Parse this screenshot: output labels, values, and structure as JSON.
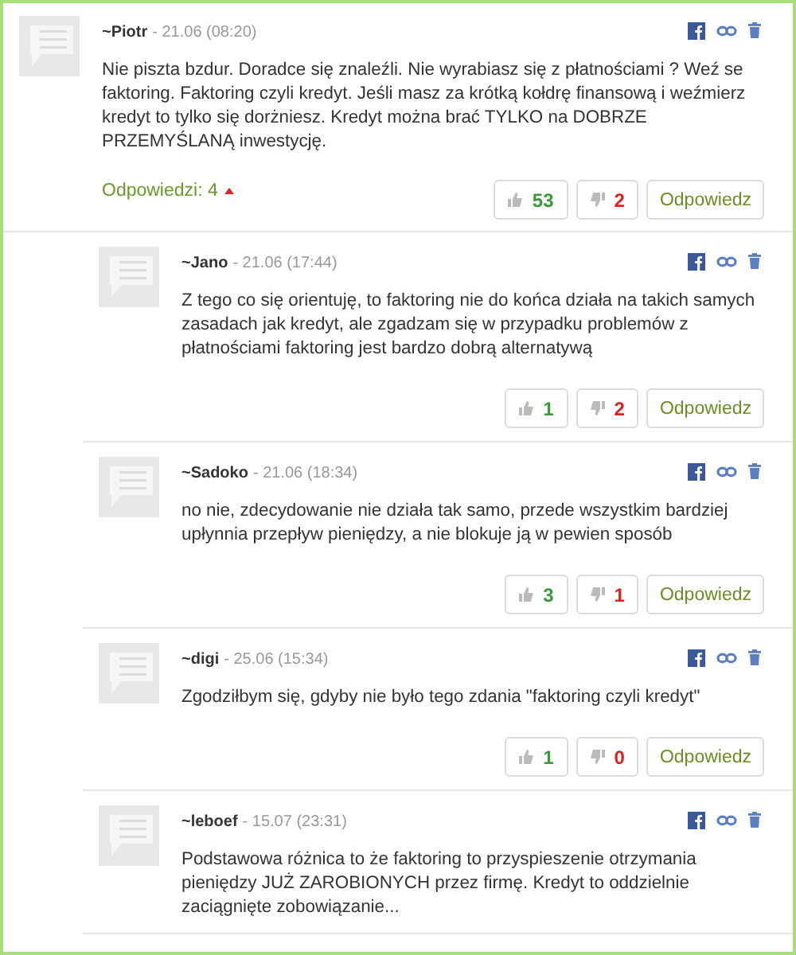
{
  "comment": {
    "author": "~Piotr",
    "date": "- 21.06 (08:20)",
    "text": "Nie piszta bzdur. Doradce się znaleźli. Nie wyrabiasz się z płatnościami ? Weź se faktoring. Faktoring czyli kredyt. Jeśli masz za krótką kołdrę finansową i weźmierz kredyt to tylko się dorżniesz. Kredyt można brać TYLKO na DOBRZE PRZEMYŚLANĄ inwestycję.",
    "likes": "53",
    "dislikes": "2",
    "reply_button": "Odpowiedz"
  },
  "replies_toggle": {
    "label": "Odpowiedzi: 4",
    "expanded": true
  },
  "replies": [
    {
      "author": "~Jano",
      "date": "- 21.06 (17:44)",
      "text": "Z tego co się orientuję, to faktoring nie do końca działa na takich samych zasadach jak kredyt, ale zgadzam się w przypadku problemów z płatnościami faktoring jest bardzo dobrą alternatywą",
      "likes": "1",
      "dislikes": "2",
      "reply_button": "Odpowiedz"
    },
    {
      "author": "~Sadoko",
      "date": "- 21.06 (18:34)",
      "text": "no nie, zdecydowanie nie działa tak samo, przede wszystkim bardziej upłynnia przepływ pieniędzy, a nie blokuje ją w pewien sposób",
      "likes": "3",
      "dislikes": "1",
      "reply_button": "Odpowiedz"
    },
    {
      "author": "~digi",
      "date": "- 25.06 (15:34)",
      "text": "Zgodziłbym się, gdyby nie było tego zdania \"faktoring czyli kredyt\"",
      "likes": "1",
      "dislikes": "0",
      "reply_button": "Odpowiedz"
    },
    {
      "author": "~leboef",
      "date": "- 15.07 (23:31)",
      "text": "Podstawowa różnica to że faktoring to przyspieszenie otrzymania pieniędzy JUŻ ZAROBIONYCH przez firmę. Kredyt to oddzielnie zaciągnięte zobowiązanie..."
    }
  ]
}
